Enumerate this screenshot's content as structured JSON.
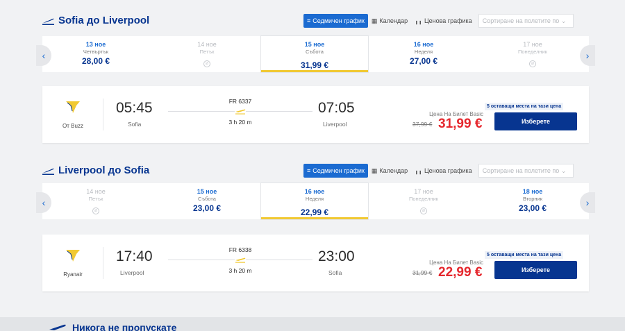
{
  "outbound": {
    "title": "Sofia до Liverpool",
    "tabs": {
      "weekly": "Седмичен график",
      "calendar": "Календар",
      "price_chart": "Ценова графика"
    },
    "sort_placeholder": "Сортиране на полетите по",
    "days": [
      {
        "date": "13 ное",
        "weekday": "Четвъртък",
        "price": "28,00 €"
      },
      {
        "date": "14 ное",
        "weekday": "Петък",
        "price": ""
      },
      {
        "date": "15 ное",
        "weekday": "Събота",
        "price": "31,99 €"
      },
      {
        "date": "16 ное",
        "weekday": "Неделя",
        "price": "27,00 €"
      },
      {
        "date": "17 ное",
        "weekday": "Понеделник",
        "price": ""
      }
    ],
    "flight": {
      "airline": "От Buzz",
      "flight_no": "FR 6337",
      "dep_time": "05:45",
      "dep_city": "Sofia",
      "arr_time": "07:05",
      "arr_city": "Liverpool",
      "duration": "3 h 20 m",
      "price_label": "Цена На Билет Basic",
      "old_price": "37,99 €",
      "price": "31,99 €",
      "seats_badge": "5 оставащи места на тази цена",
      "select_label": "Изберете"
    }
  },
  "inbound": {
    "title": "Liverpool до Sofia",
    "tabs": {
      "weekly": "Седмичен график",
      "calendar": "Календар",
      "price_chart": "Ценова графика"
    },
    "sort_placeholder": "Сортиране на полетите по",
    "days": [
      {
        "date": "14 ное",
        "weekday": "Петък",
        "price": ""
      },
      {
        "date": "15 ное",
        "weekday": "Събота",
        "price": "23,00 €"
      },
      {
        "date": "16 ное",
        "weekday": "Неделя",
        "price": "22,99 €"
      },
      {
        "date": "17 ное",
        "weekday": "Понеделник",
        "price": ""
      },
      {
        "date": "18 ное",
        "weekday": "Вторник",
        "price": "23,00 €"
      }
    ],
    "flight": {
      "airline": "Ryanair",
      "flight_no": "FR 6338",
      "dep_time": "17:40",
      "dep_city": "Liverpool",
      "arr_time": "23:00",
      "arr_city": "Sofia",
      "duration": "3 h 20 m",
      "price_label": "Цена На Билет Basic",
      "old_price": "31,99 €",
      "price": "22,99 €",
      "seats_badge": "5 оставащи места на тази цена",
      "select_label": "Изберете"
    }
  },
  "footer": {
    "title": "Никога не пропускате"
  },
  "colors": {
    "brand_blue": "#073590",
    "accent_blue": "#1b6bd1",
    "price_red": "#e5272d",
    "selected_bar": "#f1c933",
    "logo_yellow": "#f1c933"
  }
}
